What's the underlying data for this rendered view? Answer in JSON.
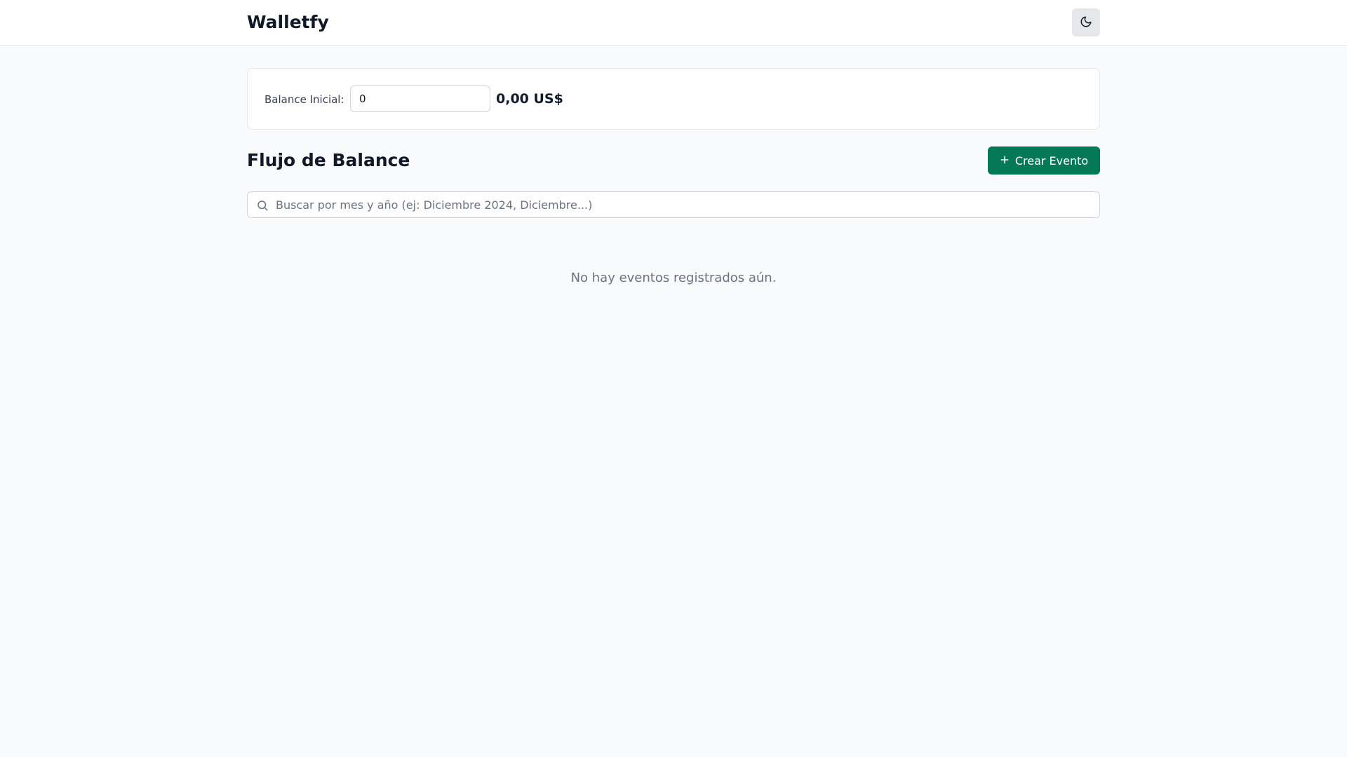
{
  "header": {
    "brand": "Walletfy",
    "theme_toggle_icon": "moon-icon"
  },
  "balance": {
    "label": "Balance Inicial:",
    "input_value": "0",
    "amount": "0,00 US$"
  },
  "section": {
    "title": "Flujo de Balance",
    "create_button_icon": "plus-icon",
    "create_button_label": "Crear Evento"
  },
  "search": {
    "icon": "search-icon",
    "placeholder": "Buscar por mes y año (ej: Diciembre 2024, Diciembre...)",
    "value": ""
  },
  "events": {
    "empty_message": "No hay eventos registrados aún."
  },
  "colors": {
    "accent": "#047857",
    "background": "#f8fafc",
    "surface": "#ffffff",
    "text_primary": "#111827",
    "text_muted": "#6b7280"
  }
}
